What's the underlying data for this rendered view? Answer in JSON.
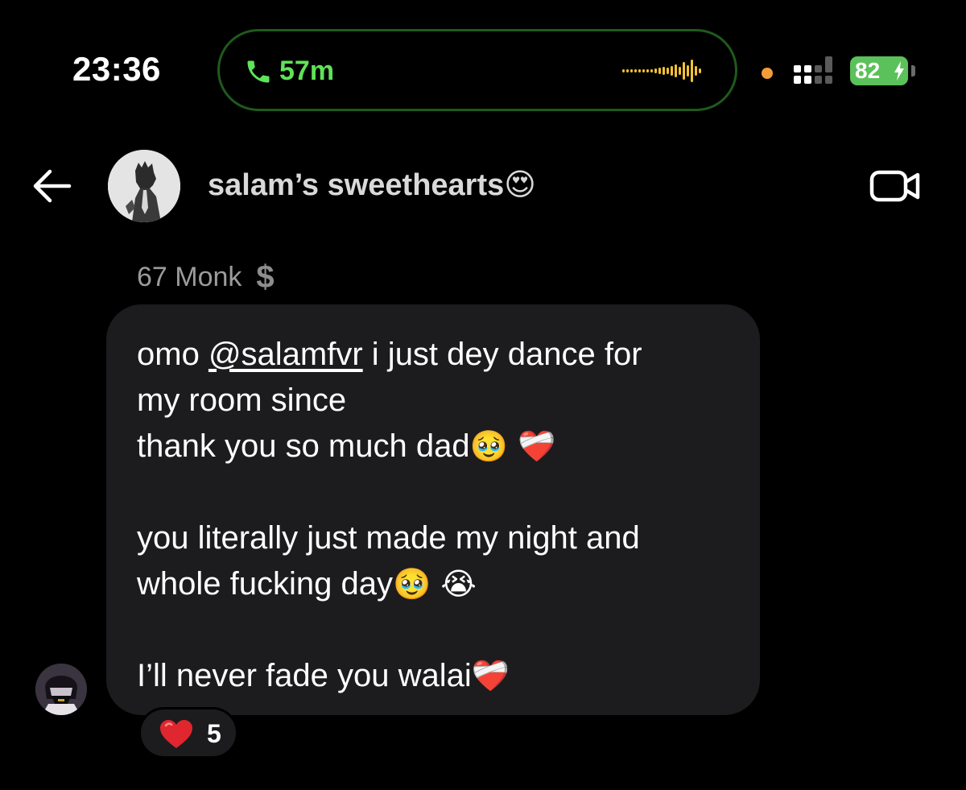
{
  "status_bar": {
    "time": "23:36",
    "call_duration": "57m",
    "battery_level": "82",
    "colors": {
      "call_green": "#5fe357",
      "pill_border": "#1f5a1c",
      "battery_green": "#5bc15a",
      "privacy_dot": "#f39c3a",
      "waveform": "#f2c230"
    },
    "icons": [
      "phone-icon",
      "audio-waveform-icon",
      "signal-icon",
      "battery-icon",
      "charging-bolt-icon"
    ]
  },
  "header": {
    "title": "salam’s sweethearts",
    "title_emoji": "😍",
    "icons": [
      "back-arrow-icon",
      "group-avatar",
      "video-camera-icon"
    ]
  },
  "message": {
    "sender": "67 Monk",
    "sender_badge_icon": "dollar-sign-icon",
    "lines": {
      "l1_prefix": "omo ",
      "l1_mention": "@salamfvr",
      "l1_suffix": " i just dey dance for",
      "l2": "my room since",
      "l3": "thank you so much dad",
      "l3_emoji": "🥹 ❤️‍🩹",
      "l5": "you literally just made my night and",
      "l6": "whole fucking day",
      "l6_emoji": "🥹 😭",
      "l8": "I’ll never fade you walai",
      "l8_emoji": "❤️‍🩹"
    },
    "reaction": {
      "icon": "red-heart-icon",
      "count": "5"
    },
    "bubble_color": "#1c1c1e"
  }
}
